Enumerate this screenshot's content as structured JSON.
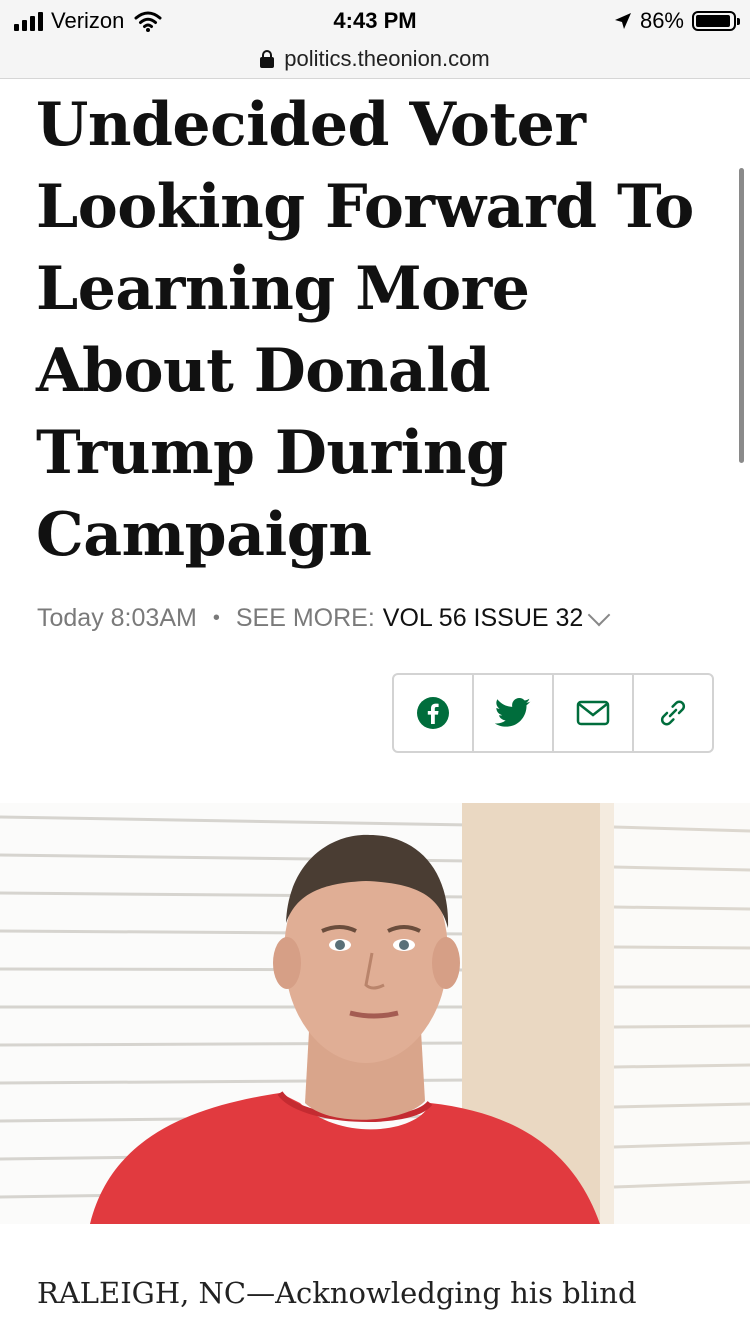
{
  "status_bar": {
    "carrier": "Verizon",
    "time": "4:43 PM",
    "battery": "86%",
    "battery_level": 0.86
  },
  "browser": {
    "url": "politics.theonion.com"
  },
  "article": {
    "headline": "Undecided Voter Looking Forward To Learning More About Donald Trump During Campaign",
    "timestamp": "Today 8:03AM",
    "see_more_label": "SEE MORE:",
    "issue": "VOL 56 ISSUE 32",
    "lede": "RALEIGH, NC—Acknowledging his blind"
  },
  "share": {
    "buttons": [
      "facebook-icon",
      "twitter-icon",
      "email-icon",
      "link-icon"
    ],
    "accent_color": "#006d3c"
  }
}
